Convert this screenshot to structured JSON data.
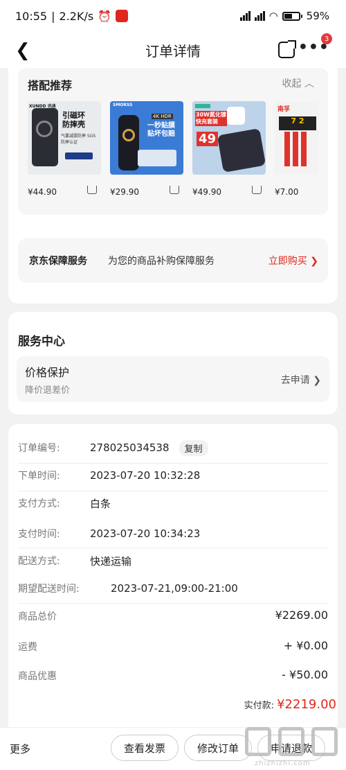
{
  "status": {
    "time": "10:55",
    "speed": "2.2K/s",
    "battery": "59%"
  },
  "header": {
    "title": "订单详情",
    "badge": "3"
  },
  "recommend": {
    "title": "搭配推荐",
    "collapse": "收起",
    "products": [
      {
        "brand": "XUNDD 讯迪",
        "headline": "引磁环\n防摔壳",
        "sub": "气囊减震防摔 SGS防摔认证",
        "price": "¥44.90"
      },
      {
        "brand": "SMORSS",
        "headline": "一秒贴膜\n贴坏包赔",
        "sub": "4K HDR",
        "price": "¥29.90"
      },
      {
        "brand": "",
        "headline": "30W氮化镓\n快充套装",
        "sub": "49",
        "price": "¥49.90"
      },
      {
        "brand": "南孚",
        "headline": "7 2",
        "sub": "",
        "price": "¥7.00"
      }
    ]
  },
  "guard": {
    "title": "京东保障服务",
    "desc": "为您的商品补购保障服务",
    "action": "立即购买 ❯"
  },
  "service": {
    "title": "服务中心",
    "item": "价格保护",
    "sub": "降价退差价",
    "go": "去申请 ❯"
  },
  "order": {
    "no_label": "订单编号:",
    "no": "278025034538",
    "copy": "复制",
    "time_label": "下单时间:",
    "time": "2023-07-20 10:32:28",
    "paymethod_label": "支付方式:",
    "paymethod": "白条",
    "paytime_label": "支付时间:",
    "paytime": "2023-07-20 10:34:23",
    "ship_label": "配送方式:",
    "ship": "快递运输",
    "expect_label": "期望配送时间:",
    "expect": "2023-07-21,09:00-21:00",
    "total_label": "商品总价",
    "total": "¥2269.00",
    "freight_label": "运费",
    "freight": "+ ¥0.00",
    "discount_label": "商品优惠",
    "discount": "- ¥50.00",
    "paid_label": "实付款:",
    "paid": "¥2219.00"
  },
  "bottom": {
    "more": "更多",
    "invoice": "查看发票",
    "modify": "修改订单",
    "refund": "申请退款"
  },
  "watermark": "zhizhizhi.com"
}
